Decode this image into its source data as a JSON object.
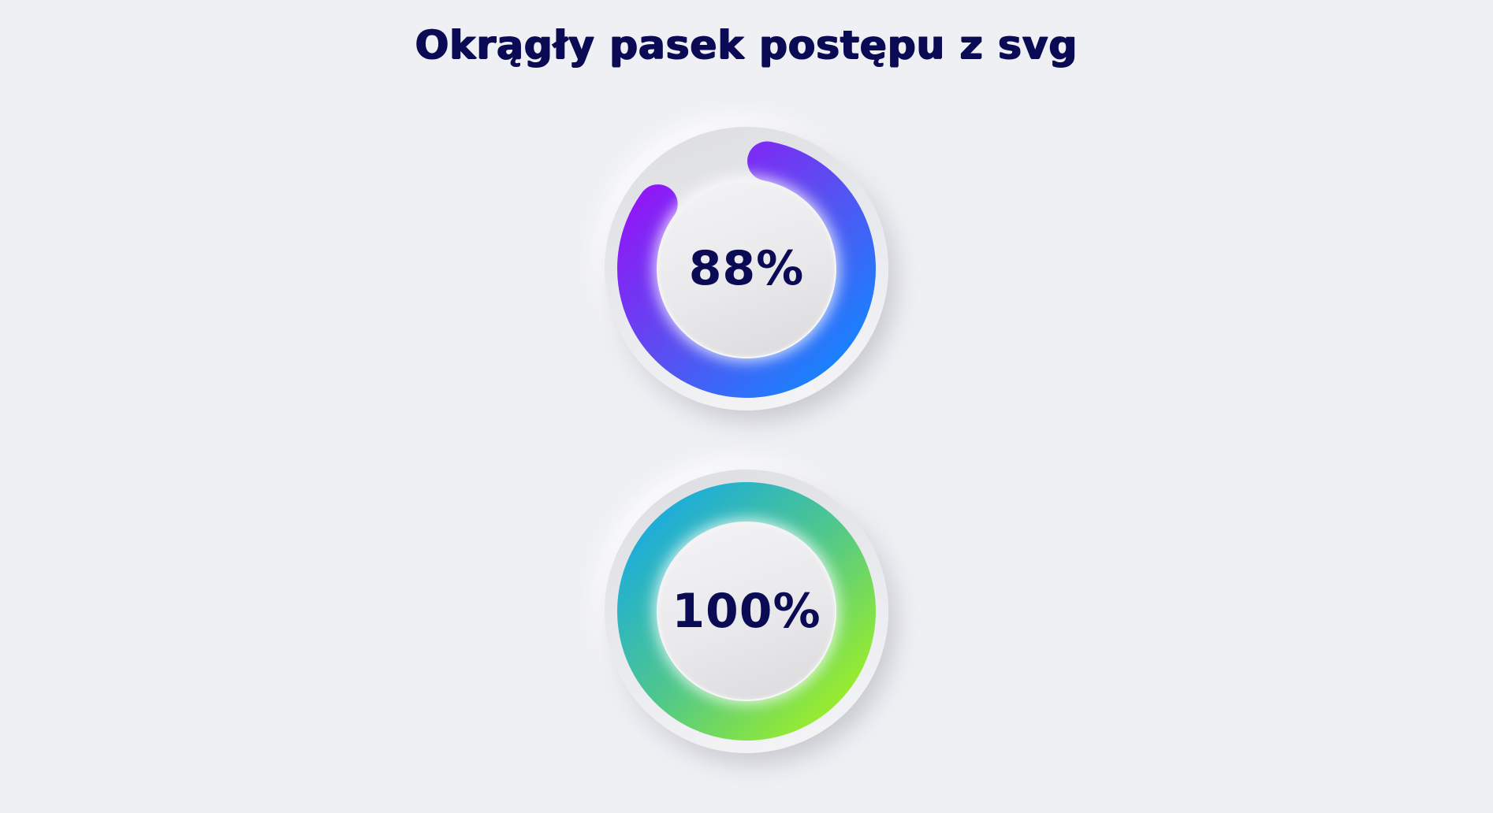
{
  "page": {
    "title": "Okrągły pasek postępu z svg"
  },
  "progress_bars": [
    {
      "label": "88%",
      "value": 0.88,
      "gradient": [
        "#0e8bff",
        "#5b4ef0",
        "#9b0cf8"
      ]
    },
    {
      "label": "100%",
      "value": 1.0,
      "gradient": [
        "#a6f31c",
        "#4fc78c",
        "#14a8e8"
      ]
    }
  ]
}
